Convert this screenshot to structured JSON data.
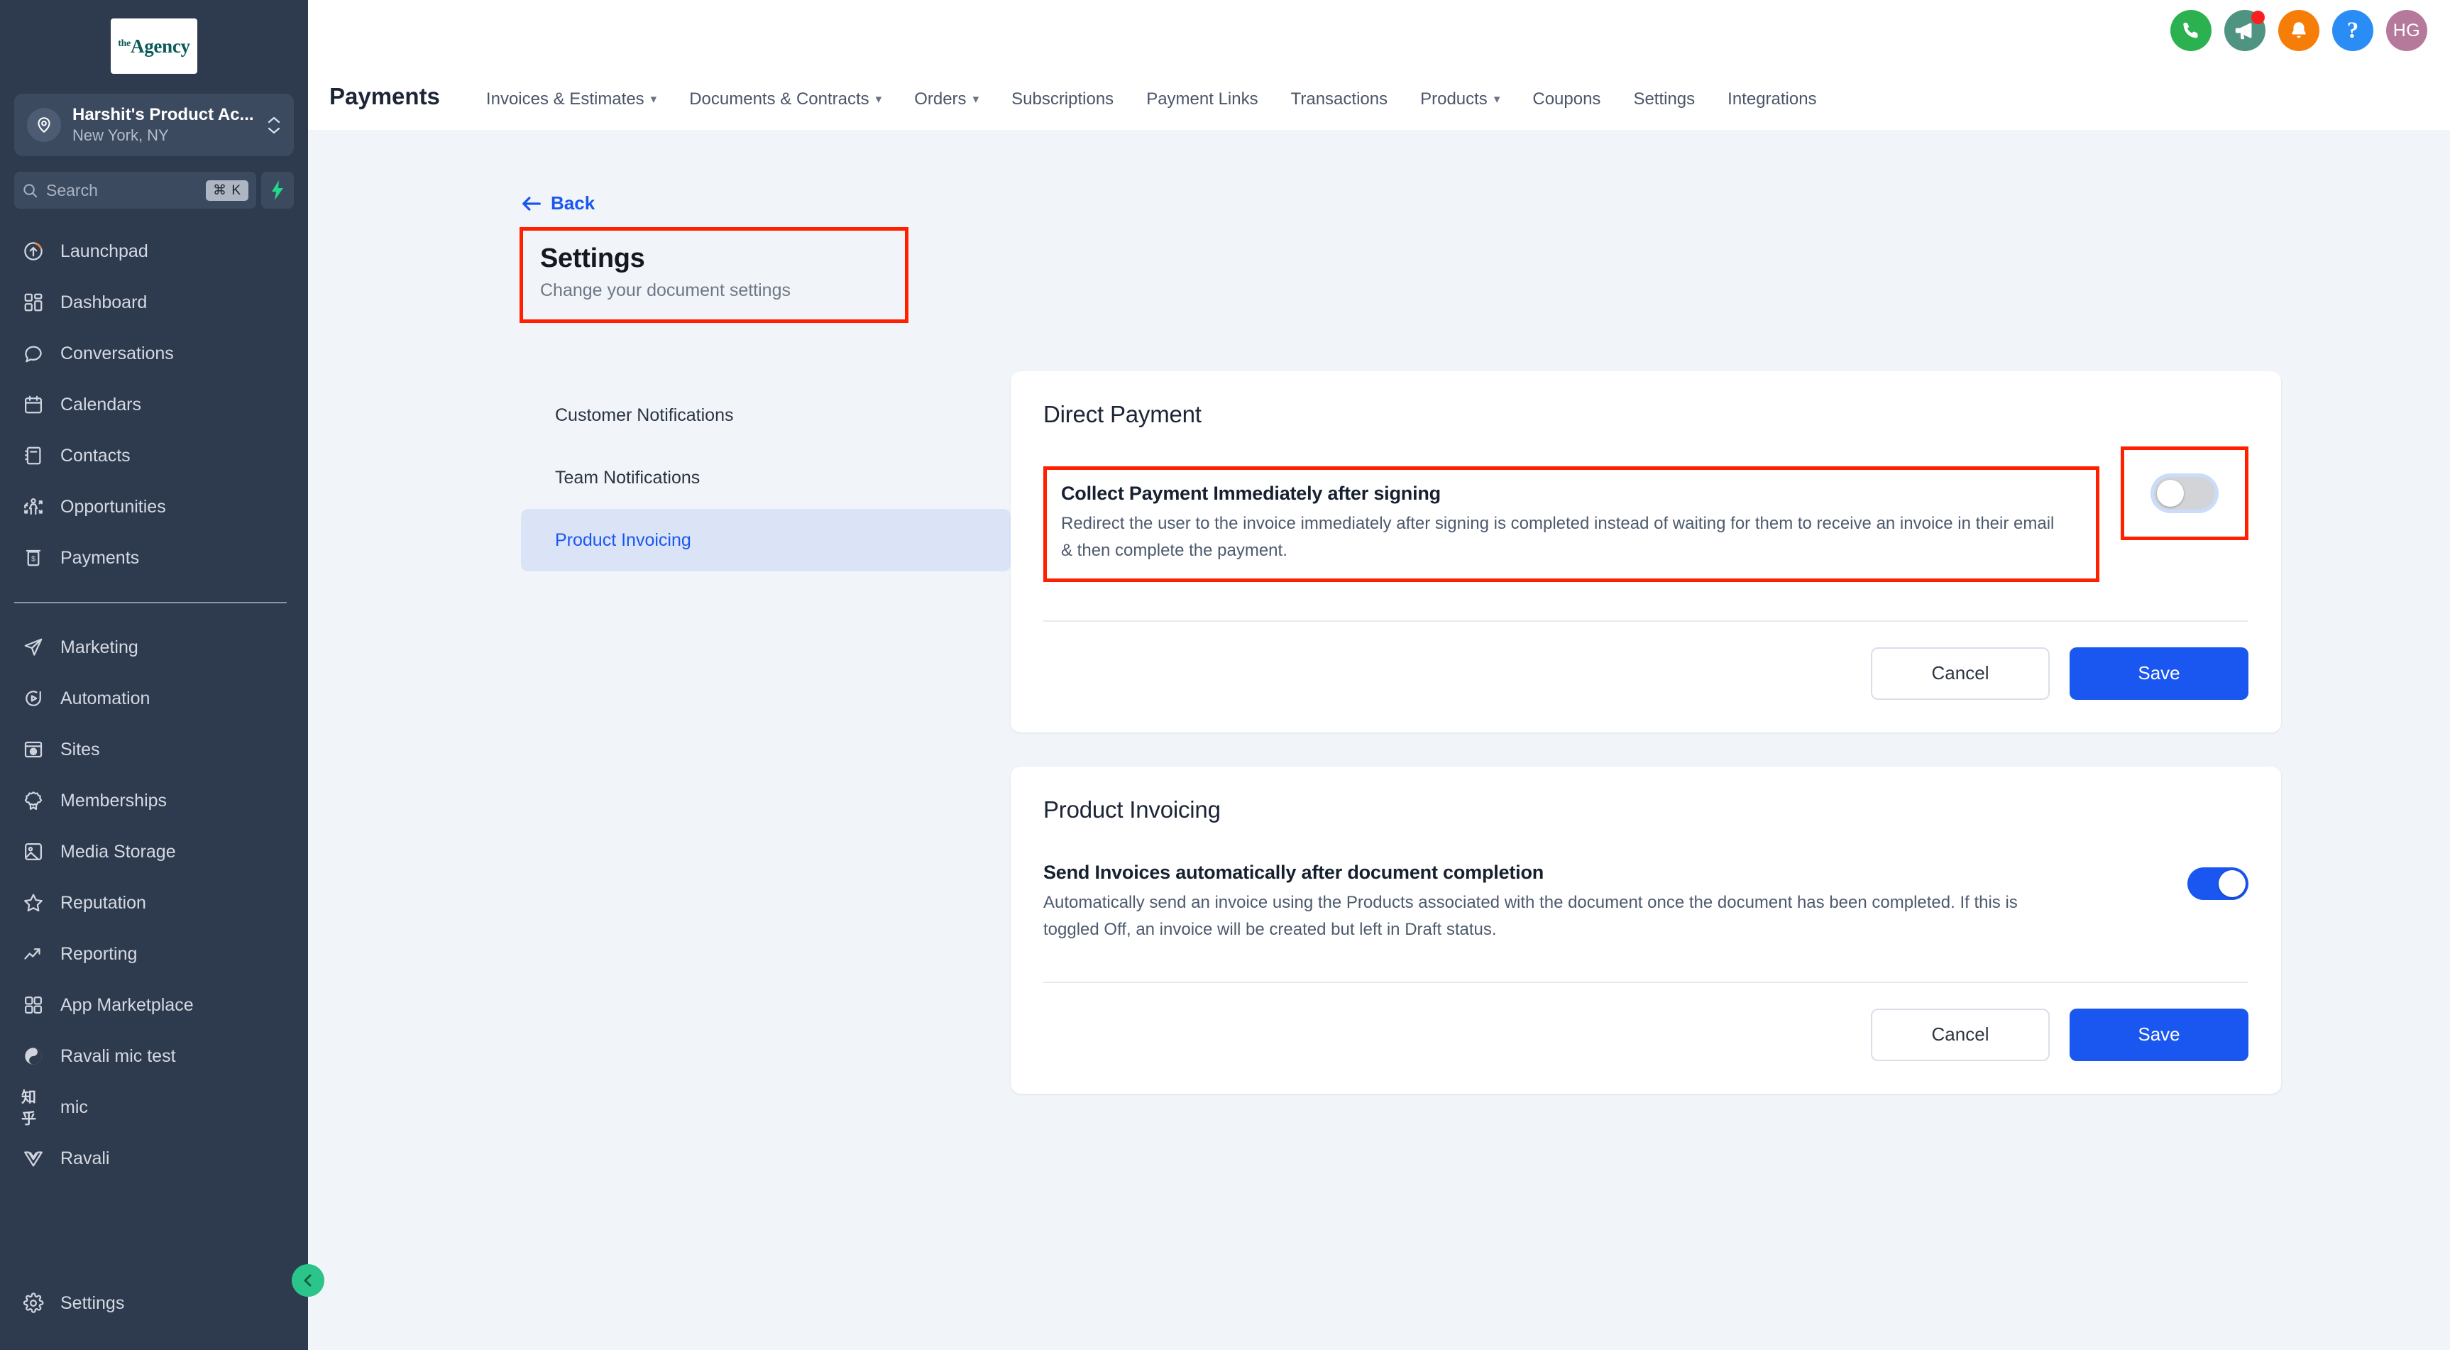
{
  "sidebar": {
    "logo": {
      "prefix": "the",
      "name": "Agency"
    },
    "location": {
      "name": "Harshit's Product Ac...",
      "sub": "New York, NY"
    },
    "search": {
      "placeholder": "Search",
      "shortcut": "⌘ K"
    },
    "primary_items": [
      {
        "label": "Launchpad",
        "icon": "launchpad-icon"
      },
      {
        "label": "Dashboard",
        "icon": "dashboard-icon"
      },
      {
        "label": "Conversations",
        "icon": "conversations-icon"
      },
      {
        "label": "Calendars",
        "icon": "calendar-icon"
      },
      {
        "label": "Contacts",
        "icon": "contacts-icon"
      },
      {
        "label": "Opportunities",
        "icon": "opportunities-icon"
      },
      {
        "label": "Payments",
        "icon": "payments-icon"
      }
    ],
    "secondary_items": [
      {
        "label": "Marketing",
        "icon": "marketing-icon"
      },
      {
        "label": "Automation",
        "icon": "automation-icon"
      },
      {
        "label": "Sites",
        "icon": "sites-icon"
      },
      {
        "label": "Memberships",
        "icon": "memberships-icon"
      },
      {
        "label": "Media Storage",
        "icon": "media-storage-icon"
      },
      {
        "label": "Reputation",
        "icon": "reputation-icon"
      },
      {
        "label": "Reporting",
        "icon": "reporting-icon"
      },
      {
        "label": "App Marketplace",
        "icon": "app-marketplace-icon"
      },
      {
        "label": "Ravali mic test",
        "icon": "yin-yang-icon"
      },
      {
        "label": "mic",
        "icon": "zhihu-icon",
        "glyph": "知乎"
      },
      {
        "label": "Ravali",
        "icon": "vue-icon"
      }
    ],
    "footer_item": {
      "label": "Settings",
      "icon": "gear-icon"
    },
    "collapse_button": "collapse-sidebar-button"
  },
  "topbar": {
    "page_title": "Payments",
    "tabs": [
      {
        "label": "Invoices & Estimates",
        "has_caret": true
      },
      {
        "label": "Documents & Contracts",
        "has_caret": true
      },
      {
        "label": "Orders",
        "has_caret": true
      },
      {
        "label": "Subscriptions",
        "has_caret": false
      },
      {
        "label": "Payment Links",
        "has_caret": false
      },
      {
        "label": "Transactions",
        "has_caret": false
      },
      {
        "label": "Products",
        "has_caret": true
      },
      {
        "label": "Coupons",
        "has_caret": false
      },
      {
        "label": "Settings",
        "has_caret": false
      },
      {
        "label": "Integrations",
        "has_caret": false
      }
    ],
    "icons": [
      {
        "name": "phone-icon",
        "color": "#2bb14f"
      },
      {
        "name": "megaphone-icon",
        "color": "#4e9480",
        "badge": true
      },
      {
        "name": "bell-icon",
        "color": "#f77d09"
      },
      {
        "name": "help-icon",
        "color": "#2a8cf5",
        "glyph": "?"
      },
      {
        "name": "user-avatar",
        "color": "#b5799b",
        "initials": "HG"
      }
    ]
  },
  "content": {
    "back_label": "Back",
    "heading": "Settings",
    "subheading": "Change your document settings",
    "submenu": [
      {
        "label": "Customer Notifications",
        "active": false
      },
      {
        "label": "Team Notifications",
        "active": false
      },
      {
        "label": "Product Invoicing",
        "active": true
      }
    ],
    "cards": [
      {
        "title": "Direct Payment",
        "setting_title": "Collect Payment Immediately after signing",
        "setting_desc": "Redirect the user to the invoice immediately after signing is completed instead of waiting for them to receive an invoice in their email & then complete the payment.",
        "toggle_state": "off",
        "cancel_label": "Cancel",
        "save_label": "Save"
      },
      {
        "title": "Product Invoicing",
        "setting_title": "Send Invoices automatically after document completion",
        "setting_desc": "Automatically send an invoice using the Products associated with the document once the document has been completed. If this is toggled Off, an invoice will be created but left in Draft status.",
        "toggle_state": "on",
        "cancel_label": "Cancel",
        "save_label": "Save"
      }
    ]
  },
  "colors": {
    "sidebar_bg": "#2e3a4e",
    "page_bg": "#f1f5f9",
    "accent_blue": "#1a56f0",
    "annotation_red": "#ff2000",
    "collapse_green": "#2bc48a"
  }
}
